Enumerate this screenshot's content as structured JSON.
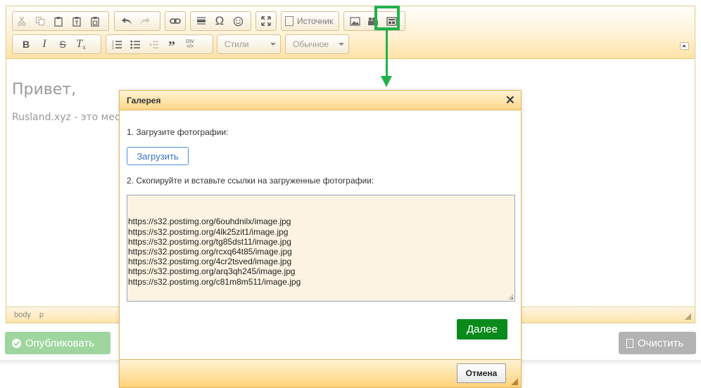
{
  "toolbar": {
    "source_label": "Источник",
    "styles_label": "Стили",
    "format_label": "Обычное",
    "div_label": "DIV"
  },
  "content": {
    "heading": "Привет,",
    "paragraph": "Rusland.xyz - это мес"
  },
  "statusbar": {
    "path": [
      "body",
      "p"
    ]
  },
  "buttons": {
    "publish": "Опубликовать",
    "clear": "Очистить"
  },
  "dialog": {
    "title": "Галерея",
    "step1": "1. Загрузите фотографии:",
    "upload_label": "Загрузить",
    "step2": "2. Скопируйте и вставьте ссылки на загруженные фотографии:",
    "links": [
      "https://s32.postimg.org/6ouhdnilx/image.jpg",
      "https://s32.postimg.org/4lk25zit1/image.jpg",
      "https://s32.postimg.org/tg85dst11/image.jpg",
      "https://s32.postimg.org/rcxq64t85/image.jpg",
      "https://s32.postimg.org/4cr2tsved/image.jpg",
      "https://s32.postimg.org/arq3qh245/image.jpg",
      "https://s32.postimg.org/c81m8m511/image.jpg"
    ],
    "next_label": "Далее",
    "cancel_label": "Отмена"
  },
  "colors": {
    "highlight": "#22b14c",
    "next_button": "#0b8a1c",
    "publish_button": "#9fd69f",
    "clear_button": "#b3b3b3"
  }
}
